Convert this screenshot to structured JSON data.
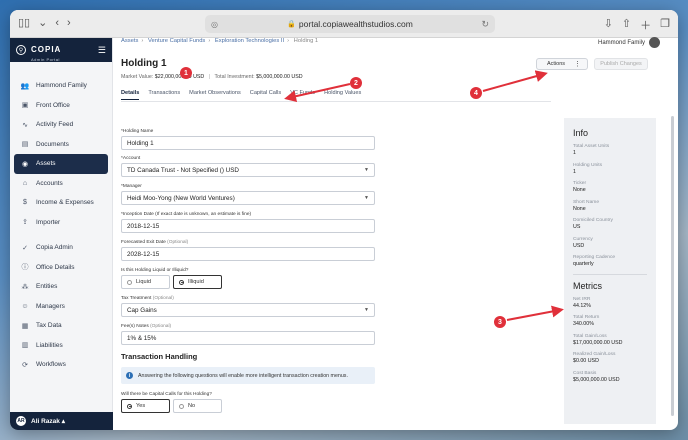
{
  "browser": {
    "url": "portal.copiawealthstudios.com"
  },
  "brand": {
    "name": "COPIA",
    "subtitle": "Admin Portal"
  },
  "sidebar": {
    "items": [
      {
        "label": "Hammond Family",
        "icon": "people-icon"
      },
      {
        "label": "Front Office",
        "icon": "briefcase-icon"
      },
      {
        "label": "Activity Feed",
        "icon": "pulse-icon"
      },
      {
        "label": "Documents",
        "icon": "document-icon"
      },
      {
        "label": "Assets",
        "icon": "asset-icon",
        "active": true
      },
      {
        "label": "Accounts",
        "icon": "bank-icon"
      },
      {
        "label": "Income & Expenses",
        "icon": "money-icon"
      },
      {
        "label": "Importer",
        "icon": "import-icon"
      },
      {
        "label": "Copia Admin",
        "icon": "check-circle-icon"
      },
      {
        "label": "Office Details",
        "icon": "info-icon"
      },
      {
        "label": "Entities",
        "icon": "entities-icon"
      },
      {
        "label": "Managers",
        "icon": "manager-icon"
      },
      {
        "label": "Tax Data",
        "icon": "tax-icon"
      },
      {
        "label": "Liabilities",
        "icon": "liabilities-icon"
      },
      {
        "label": "Workflows",
        "icon": "workflow-icon"
      }
    ],
    "user": {
      "initials": "AR",
      "name": "Ali Razak ▴"
    }
  },
  "breadcrumb": {
    "items": [
      "Assets",
      "Venture Capital Funds",
      "Exploration Technologies II"
    ],
    "current": "Holding 1"
  },
  "header": {
    "family": "Hammond Family",
    "title": "Holding 1",
    "market_value_label": "Market Value:",
    "market_value": "$22,000,000.00 USD",
    "total_investment_label": "Total Investment:",
    "total_investment": "$5,000,000.00 USD",
    "actions_label": "Actions",
    "publish_label": "Publish Changes"
  },
  "tabs": [
    "Details",
    "Transactions",
    "Market Observations",
    "Capital Calls",
    "VC Funds",
    "Holding Values"
  ],
  "form": {
    "holding_name_label": "*Holding Name",
    "holding_name": "Holding 1",
    "account_label": "*Account",
    "account": "TD Canada Trust - Not Specified () USD",
    "manager_label": "*Manager",
    "manager": "Heidi Moo-Yong (New World Ventures)",
    "inception_label": "*Inception Date (If exact date is unknown, an estimate is fine)",
    "inception": "2018-12-15",
    "exit_label": "Forecasted Exit Date",
    "exit_opt": "(Optional)",
    "exit": "2028-12-15",
    "liquid_label": "Is this Holding Liquid or Illiquid?",
    "liquid": "Liquid",
    "illiquid": "Illiquid",
    "tax_label": "Tax Treatment",
    "tax_opt": "(Optional)",
    "tax": "Cap Gains",
    "fees_label": "Fee(s) Notes",
    "fees_opt": "(Optional)",
    "fees": "1% & 15%",
    "transaction_title": "Transaction Handling",
    "info_text": "Answering the following questions will enable more intelligent transaction creation menus.",
    "capital_calls_label": "Will there be Capital Calls for this Holding?",
    "yes": "Yes",
    "no": "No"
  },
  "info_panel": {
    "title": "Info",
    "rows": [
      {
        "k": "Total Asset Units",
        "v": "1"
      },
      {
        "k": "Holding Units",
        "v": "1"
      },
      {
        "k": "Ticker",
        "v": "None"
      },
      {
        "k": "Short Name",
        "v": "None"
      },
      {
        "k": "Domiciled Country",
        "v": "US"
      },
      {
        "k": "Currency",
        "v": "USD"
      },
      {
        "k": "Reporting Cadence",
        "v": "quarterly"
      }
    ],
    "metrics_title": "Metrics",
    "metrics": [
      {
        "k": "Net IRR",
        "v": "44.12%"
      },
      {
        "k": "Total Return",
        "v": "340.00%"
      },
      {
        "k": "Total Gain/Loss",
        "v": "$17,000,000.00 USD"
      },
      {
        "k": "Realized Gain/Loss",
        "v": "$0.00 USD"
      },
      {
        "k": "Cost Basis",
        "v": "$5,000,000.00 USD"
      }
    ]
  },
  "callouts": [
    "1",
    "2",
    "3",
    "4"
  ],
  "colors": {
    "annotation": "#e0303a",
    "nav_active": "#1c2d4a",
    "brand": "#14233c"
  }
}
